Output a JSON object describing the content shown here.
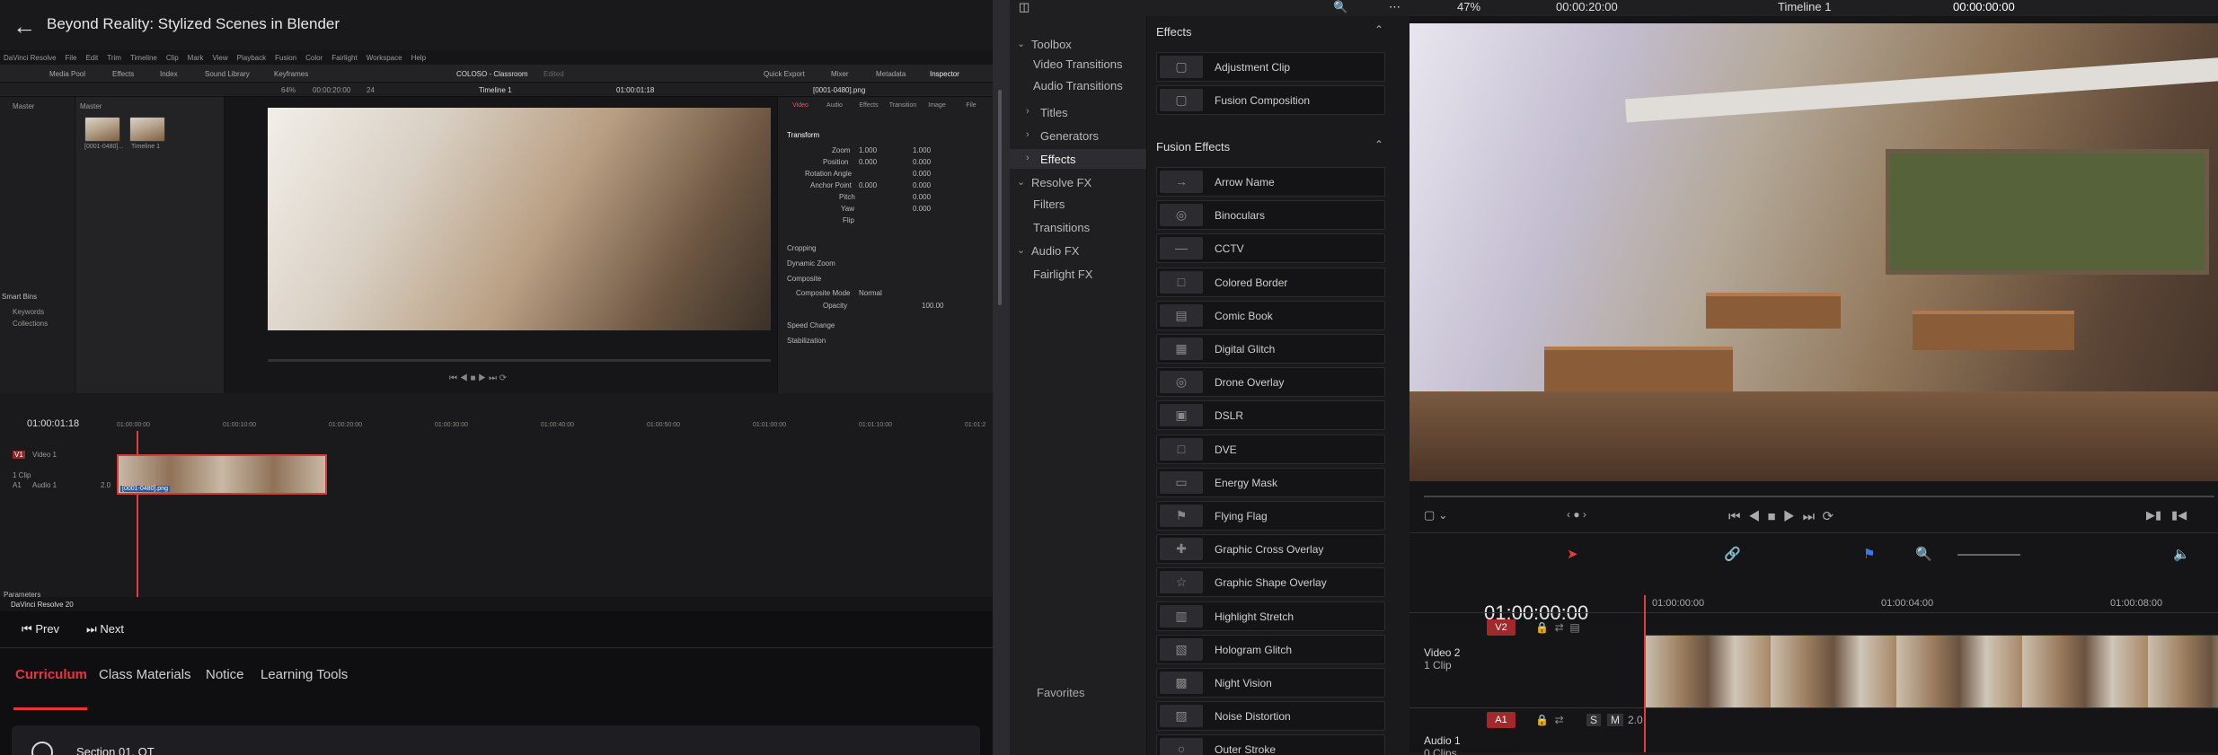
{
  "course": {
    "title": "Beyond Reality: Stylized Scenes in Blender",
    "prev": "Prev",
    "next": "Next",
    "tabs": [
      "Curriculum",
      "Class Materials",
      "Notice",
      "Learning Tools"
    ],
    "section": "Section 01. OT"
  },
  "embed": {
    "menu": [
      "DaVinci Resolve",
      "File",
      "Edit",
      "Trim",
      "Timeline",
      "Clip",
      "Mark",
      "View",
      "Playback",
      "Fusion",
      "Color",
      "Fairlight",
      "Workspace",
      "Help"
    ],
    "toolbar": {
      "media_pool": "Media Pool",
      "effects": "Effects",
      "index": "Index",
      "sound_library": "Sound Library",
      "keyframes": "Keyframes",
      "project": "COLOSO - Classroom",
      "edited": "Edited",
      "quick_export": "Quick Export",
      "mixer": "Mixer",
      "metadata": "Metadata",
      "inspector": "Inspector"
    },
    "bins": {
      "master": "Master",
      "master2": "Master",
      "smart_bins": "Smart Bins",
      "keywords": "Keywords",
      "collections": "Collections"
    },
    "clips": [
      "[0001-0480]...",
      "Timeline 1"
    ],
    "viewer": {
      "zoom": "64%",
      "timecode": "00:00:20:00",
      "fps": "24",
      "timeline": "Timeline 1",
      "tc_right": "01:00:01:18",
      "filename": "[0001-0480].png"
    },
    "inspector": {
      "tabs": [
        "Video",
        "Audio",
        "Effects",
        "Transition",
        "Image",
        "File"
      ],
      "transform": "Transform",
      "zoom": "Zoom",
      "position": "Position",
      "rotation": "Rotation Angle",
      "anchor": "Anchor Point",
      "pitch": "Pitch",
      "yaw": "Yaw",
      "flip": "Flip",
      "zoom_x": "1.000",
      "zoom_y": "1.000",
      "pos_x": "0.000",
      "pos_y": "0.000",
      "rot": "0.000",
      "anc_x": "0.000",
      "anc_y": "0.000",
      "pitch_v": "0.000",
      "yaw_v": "0.000",
      "cropping": "Cropping",
      "dynamic_zoom": "Dynamic Zoom",
      "composite": "Composite",
      "comp_mode_label": "Composite Mode",
      "comp_mode": "Normal",
      "opacity_label": "Opacity",
      "opacity": "100.00",
      "speed_change": "Speed Change",
      "stabilization": "Stabilization"
    },
    "timeline": {
      "tc": "01:00:01:18",
      "ruler": [
        "01:00:00:00",
        "01:00:10:00",
        "01:00:20:00",
        "01:00:30:00",
        "01:00:40:00",
        "01:00:50:00",
        "01:01:00:00",
        "01:01:10:00",
        "01:01:2"
      ],
      "v1": "V1",
      "video1": "Video 1",
      "clip_count": "1 Clip",
      "a1": "A1",
      "audio1": "Audio 1",
      "a_level": "2.0",
      "clip_name": "[0001-0480].png",
      "parameters": "Parameters",
      "app_name": "DaVinci Resolve 20"
    }
  },
  "resolve": {
    "top": {
      "zoom": "47%",
      "tc": "00:00:20:00",
      "timeline": "Timeline 1",
      "tc_right": "00:00:00:00"
    },
    "toolbox": [
      {
        "label": "Toolbox",
        "type": "group"
      },
      {
        "label": "Video Transitions"
      },
      {
        "label": "Audio Transitions"
      },
      {
        "label": "Titles",
        "type": "child"
      },
      {
        "label": "Generators",
        "type": "child"
      },
      {
        "label": "Effects",
        "type": "child",
        "selected": true
      },
      {
        "label": "Resolve FX",
        "type": "group"
      },
      {
        "label": "Filters"
      },
      {
        "label": "Transitions"
      },
      {
        "label": "Audio FX",
        "type": "group"
      },
      {
        "label": "Fairlight FX"
      }
    ],
    "favorites": "Favorites",
    "effects_header": "Effects",
    "effects": [
      "Adjustment Clip",
      "Fusion Composition"
    ],
    "fusion_header": "Fusion Effects",
    "fusion_effects": [
      "Arrow Name",
      "Binoculars",
      "CCTV",
      "Colored Border",
      "Comic Book",
      "Digital Glitch",
      "Drone Overlay",
      "DSLR",
      "DVE",
      "Energy Mask",
      "Flying Flag",
      "Graphic Cross Overlay",
      "Graphic Shape Overlay",
      "Highlight Stretch",
      "Hologram Glitch",
      "Night Vision",
      "Noise Distortion",
      "Outer Stroke"
    ],
    "timeline": {
      "tc": "01:00:00:00",
      "ruler": [
        "01:00:00:00",
        "01:00:04:00",
        "01:00:08:00"
      ],
      "v2": "V2",
      "video2": "Video 2",
      "v_clips": "1 Clip",
      "a1": "A1",
      "audio1": "Audio 1",
      "a_clips": "0 Clips",
      "a_level": "2.0",
      "s": "S",
      "m": "M"
    }
  }
}
